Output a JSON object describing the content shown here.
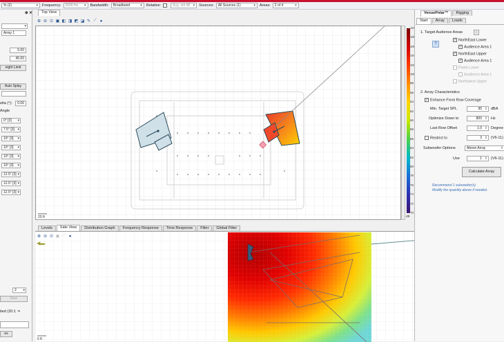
{
  "toolbar": {
    "first_value": "% (2)",
    "frequency_label": "Frequency:",
    "frequency_value": "2000 Hz",
    "bandwidth_label": "Bandwidth:",
    "bandwidth_value": "Broadband",
    "relative_label": "Relative:",
    "avg_label": "Avg. std dB",
    "sources_label": "Sources:",
    "sources_value": "All Sources (1)",
    "areas_label": "Areas:",
    "areas_value": "2 of 4"
  },
  "left_panel": {
    "close_glyph": "⊕ ✕",
    "array_name": "Array 1",
    "value_1": "5.00",
    "value_2": "45.00",
    "height_limit_button": "eight Limit",
    "auto_splay_button": "Auto Splay",
    "delta_label": "elta (°):",
    "delta_value": "0.06",
    "angle_label": "Angle",
    "angles": [
      "0° [3]",
      "7.5° [3]",
      "10° [3]",
      "10° [3]",
      "10° [3]",
      "10° [3]",
      "12.5° [3]",
      "12.5° [3]",
      "12.5° [3]"
    ],
    "count_value": "2",
    "dim_button": "Maxi",
    "status_text": "ited (20:1 :=",
    "bottom_label": "es"
  },
  "top_view": {
    "tab": "Top View",
    "scale_label": "20 ft",
    "colorbar_unit": "dB",
    "colorbar_ticks": [
      "110",
      "108",
      "106",
      "104",
      "102",
      "100",
      "98",
      "96",
      "94",
      "92",
      "90",
      "88",
      "86",
      "84",
      "82",
      "80",
      "78",
      "76",
      "74",
      "72",
      "70"
    ]
  },
  "bottom_tabs": [
    "Levels",
    "Side View",
    "Distribution Graph",
    "Frequency Response",
    "Time Response",
    "Filter",
    "Global Filter"
  ],
  "side_view": {
    "scale_label": "5 ft"
  },
  "right_panel": {
    "top_tabs": [
      "VenuePolar™",
      "Rigging"
    ],
    "sub_tabs": [
      "Start",
      "Array",
      "Loads"
    ],
    "section1_title": "1. Target Audience Areas",
    "help_glyph": "?",
    "tree": [
      {
        "label": "NorthEast Lower",
        "checked": true,
        "faded": false
      },
      {
        "label": "Audience Area 1",
        "checked": true,
        "faded": false
      },
      {
        "label": "NorthEast Upper",
        "checked": true,
        "faded": false
      },
      {
        "label": "Audience Area 1",
        "checked": true,
        "faded": false
      },
      {
        "label": "Fixed Lower",
        "checked": false,
        "faded": true
      },
      {
        "label": "Audience Area 1",
        "checked": false,
        "faded": true
      },
      {
        "label": "Northwest Upper",
        "checked": false,
        "faded": true
      }
    ],
    "section2_title": "2. Array Characteristics",
    "enhance_label": "Enhance Front Row Coverage",
    "min_spl_label": "Min. Target SPL",
    "min_spl_value": "95",
    "min_spl_unit": "dBA",
    "optimize_label": "Optimize Down to",
    "optimize_value": "800",
    "optimize_unit": "Hz",
    "last_row_label": "Last Row Offset",
    "last_row_value": "1.0",
    "last_row_unit": "Degree",
    "restrict_label": "Restrict to",
    "restrict_value": "3",
    "restrict_unit": "(V6-11)",
    "sub_options_label": "Subwoofer Options",
    "sub_options_value": "Above Array",
    "use_label": "Use",
    "use_value": "1",
    "use_unit": "(V6-11)",
    "calc_button": "Calculate Array",
    "note_line1": "Recommend 1 subwoofer(s).",
    "note_line2": "Modify the quantity above if needed."
  },
  "colors": {
    "accent_red": "#c8102e",
    "link_blue": "#3a6fb4"
  }
}
